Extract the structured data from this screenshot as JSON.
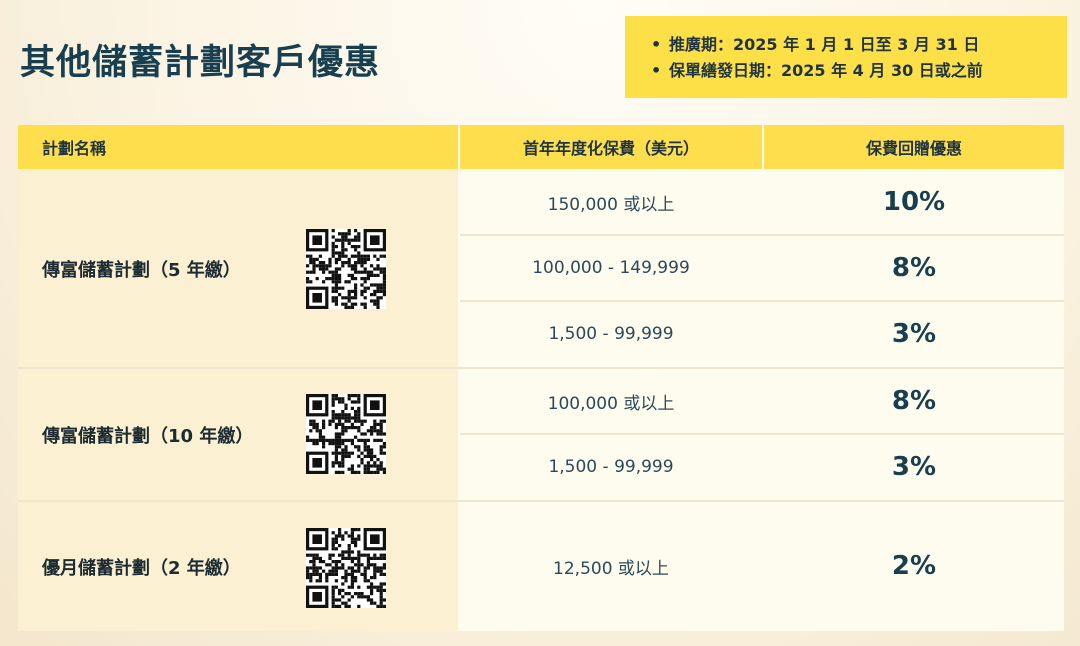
{
  "title": "其他儲蓄計劃客戶優惠",
  "promo": {
    "bullet": "•",
    "period": "推廣期：2025 年 1 月 1 日至 3 月 31 日",
    "issue_date": "保單繕發日期：2025 年 4 月 30 日或之前"
  },
  "table": {
    "headers": [
      "計劃名稱",
      "首年年度化保費（美元）",
      "保費回贈優惠"
    ],
    "plans": [
      {
        "name": "傳富儲蓄計劃（5 年繳）",
        "rows": [
          {
            "premium": "150,000 或以上",
            "rebate": "10%"
          },
          {
            "premium": "100,000 - 149,999",
            "rebate": "8%"
          },
          {
            "premium": "1,500 - 99,999",
            "rebate": "3%"
          }
        ]
      },
      {
        "name": "傳富儲蓄計劃（10 年繳）",
        "rows": [
          {
            "premium": "100,000 或以上",
            "rebate": "8%"
          },
          {
            "premium": "1,500 - 99,999",
            "rebate": "3%"
          }
        ]
      },
      {
        "name": "優月儲蓄計劃（2 年繳）",
        "rows": [
          {
            "premium": "12,500 或以上",
            "rebate": "2%"
          }
        ]
      }
    ]
  },
  "colors": {
    "accent_yellow": "#fde047",
    "text_dark": "#173f4f"
  },
  "icons": [
    "qr-code-icon"
  ]
}
